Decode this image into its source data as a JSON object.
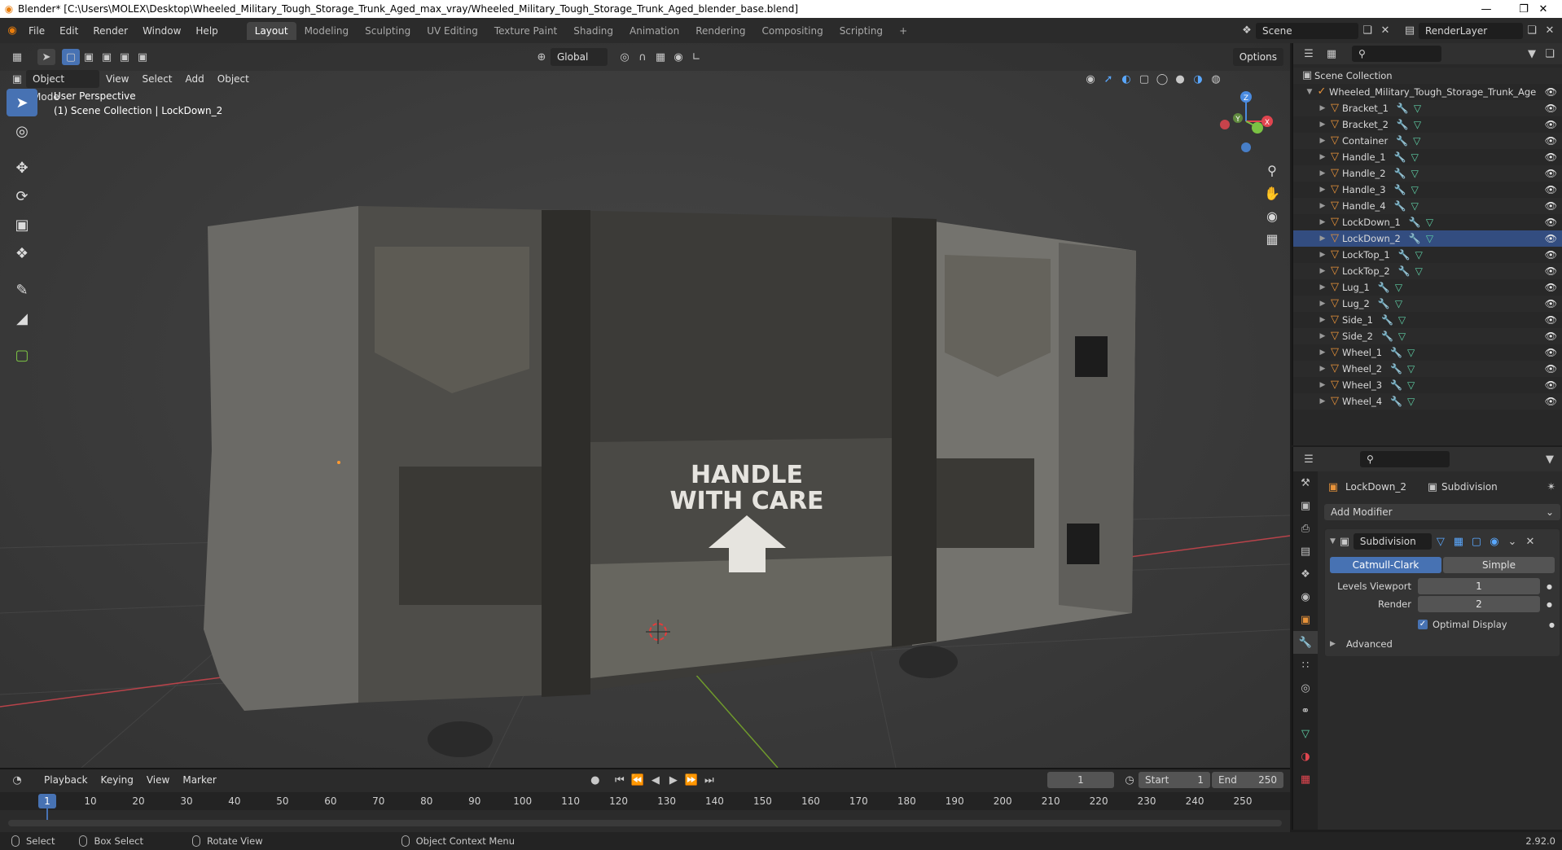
{
  "window": {
    "title": "Blender* [C:\\Users\\MOLEX\\Desktop\\Wheeled_Military_Tough_Storage_Trunk_Aged_max_vray/Wheeled_Military_Tough_Storage_Trunk_Aged_blender_base.blend]",
    "minimize": "—",
    "maximize": "❐",
    "close": "✕"
  },
  "menu": [
    "File",
    "Edit",
    "Render",
    "Window",
    "Help"
  ],
  "workspaces": {
    "tabs": [
      "Layout",
      "Modeling",
      "Sculpting",
      "UV Editing",
      "Texture Paint",
      "Shading",
      "Animation",
      "Rendering",
      "Compositing",
      "Scripting"
    ],
    "active": "Layout",
    "add": "+"
  },
  "scene": {
    "name": "Scene",
    "view_layer": "RenderLayer"
  },
  "viewport_header": {
    "transform_orientation": "Global",
    "mode": "Object Mode",
    "menus": [
      "View",
      "Select",
      "Add",
      "Object"
    ],
    "options": "Options"
  },
  "viewport": {
    "info_line1": "User Perspective",
    "info_line2": "(1) Scene Collection | LockDown_2",
    "decal_line1": "HANDLE",
    "decal_line2": "WITH CARE",
    "gizmo_axes": {
      "x": "X",
      "y": "Y",
      "z": "Z"
    }
  },
  "outliner": {
    "root": "Scene Collection",
    "collection": "Wheeled_Military_Tough_Storage_Trunk_Age",
    "objects": [
      "Bracket_1",
      "Bracket_2",
      "Container",
      "Handle_1",
      "Handle_2",
      "Handle_3",
      "Handle_4",
      "LockDown_1",
      "LockDown_2",
      "LockTop_1",
      "LockTop_2",
      "Lug_1",
      "Lug_2",
      "Side_1",
      "Side_2",
      "Wheel_1",
      "Wheel_2",
      "Wheel_3",
      "Wheel_4"
    ],
    "selected": "LockDown_2"
  },
  "properties": {
    "object": "LockDown_2",
    "modifier_tab": "Subdivision",
    "add_modifier": "Add Modifier",
    "modifier": {
      "name": "Subdivision",
      "type_catmull": "Catmull-Clark",
      "type_simple": "Simple",
      "levels_viewport_label": "Levels Viewport",
      "levels_viewport": "1",
      "render_label": "Render",
      "render": "2",
      "optimal_display_label": "Optimal Display",
      "optimal_display": true,
      "advanced": "Advanced"
    }
  },
  "timeline": {
    "menus": [
      "Playback",
      "Keying",
      "View",
      "Marker"
    ],
    "current_frame": "1",
    "start_label": "Start",
    "start": "1",
    "end_label": "End",
    "end": "250",
    "ticks": [
      "1",
      "10",
      "20",
      "30",
      "40",
      "50",
      "60",
      "70",
      "80",
      "90",
      "100",
      "110",
      "120",
      "130",
      "140",
      "150",
      "160",
      "170",
      "180",
      "190",
      "200",
      "210",
      "220",
      "230",
      "240",
      "250"
    ],
    "playhead": "1"
  },
  "statusbar": {
    "select": "Select",
    "box_select": "Box Select",
    "rotate_view": "Rotate View",
    "context_menu": "Object Context Menu",
    "version": "2.92.0"
  },
  "colors": {
    "accent": "#4772b3",
    "object_icon": "#e8933a",
    "x_axis": "#e0454f",
    "y_axis": "#7bc244",
    "z_axis": "#4a8be0"
  }
}
